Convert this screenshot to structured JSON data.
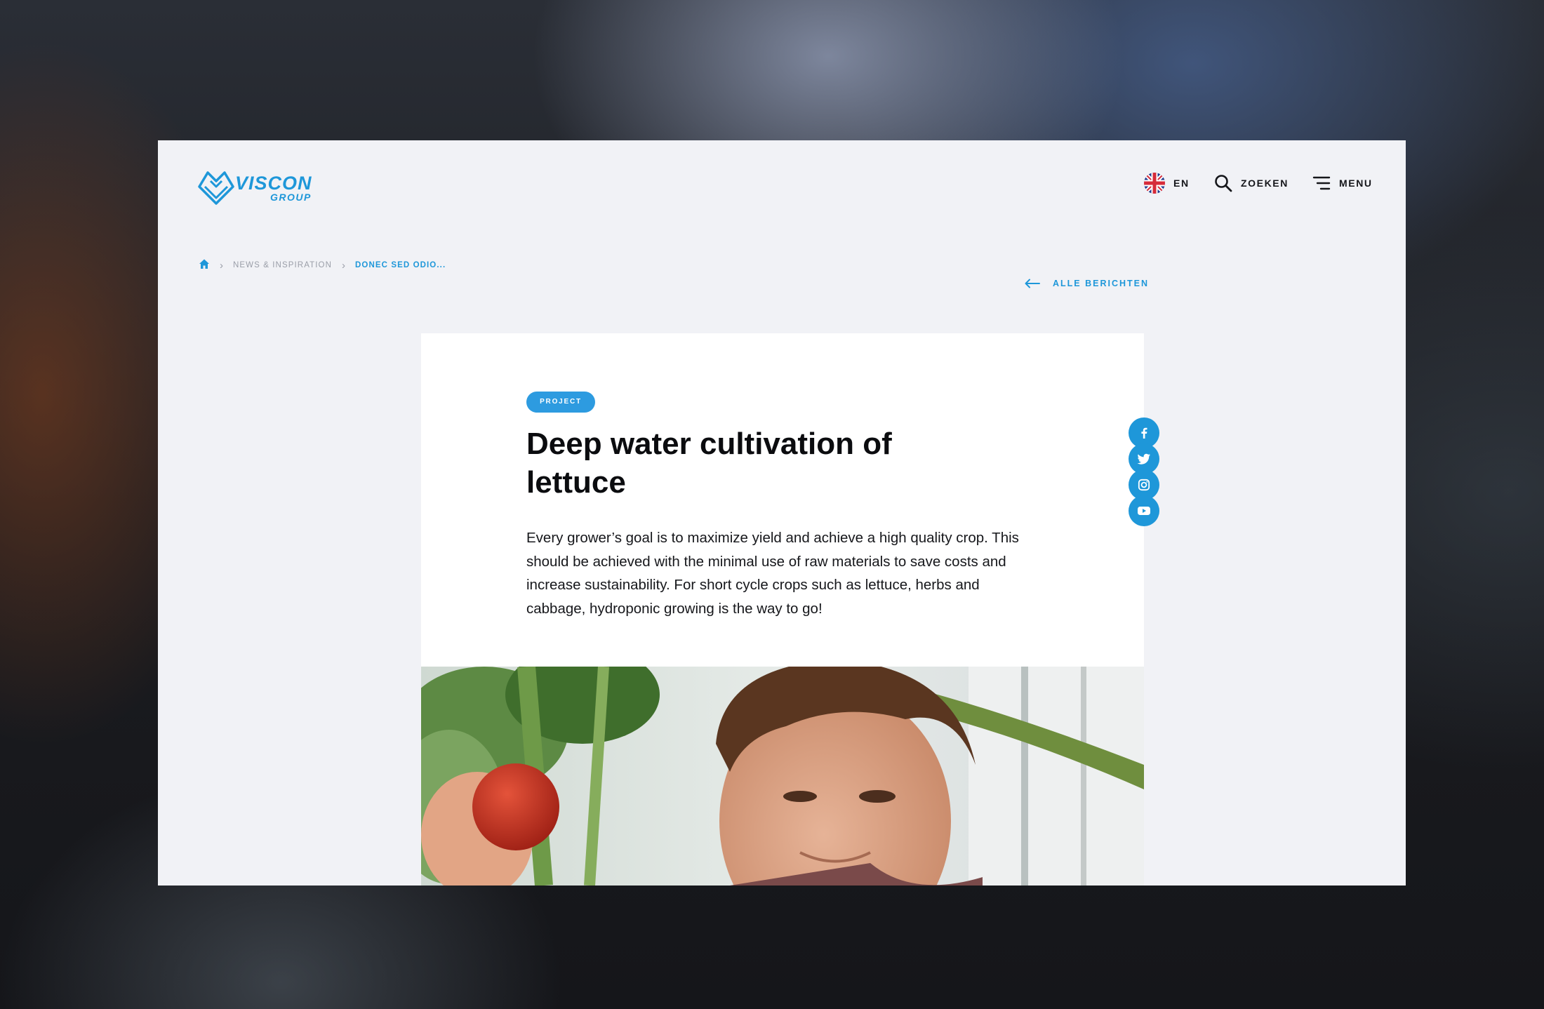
{
  "brand": {
    "name": "VISCON",
    "sub": "GROUP"
  },
  "header": {
    "language": "EN",
    "search_label": "ZOEKEN",
    "menu_label": "MENU"
  },
  "breadcrumb": {
    "items": [
      "NEWS & INSPIRATION",
      "DONEC SED ODIO..."
    ]
  },
  "back_link": {
    "label": "ALLE BERICHTEN"
  },
  "article": {
    "tag": "PROJECT",
    "title": "Deep water cultivation of lettuce",
    "intro": "Every grower’s goal is to maximize yield and achieve a high quality crop. This should be achieved with the minimal use of raw materials to save costs and increase sustainability. For short cycle crops such as lettuce, herbs and cabbage, hydroponic growing is the way to go!"
  },
  "social": [
    "facebook-icon",
    "twitter-icon",
    "instagram-icon",
    "youtube-icon"
  ],
  "colors": {
    "accent": "#1e97d9",
    "page_bg": "#f1f2f6",
    "card_bg": "#ffffff",
    "text": "#0b0c0f"
  }
}
